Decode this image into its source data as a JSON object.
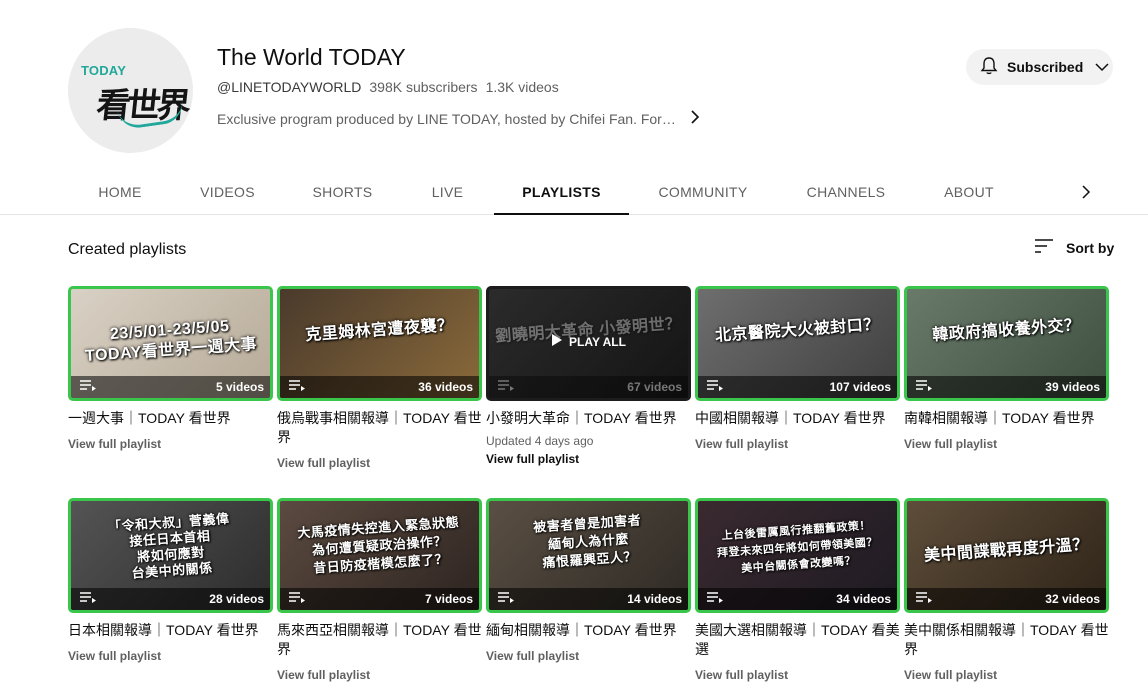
{
  "channel": {
    "avatar_text_en": "TODAY",
    "avatar_text_zh": "看世界",
    "name": "The World TODAY",
    "handle": "@LINETODAYWORLD",
    "subscribers": "398K subscribers",
    "video_count": "1.3K videos",
    "description": "Exclusive program produced by LINE TODAY, hosted by Chifei Fan. For Taiwan viewers",
    "subscribe_label": "Subscribed"
  },
  "tabs": [
    {
      "label": "HOME"
    },
    {
      "label": "VIDEOS"
    },
    {
      "label": "SHORTS"
    },
    {
      "label": "LIVE"
    },
    {
      "label": "PLAYLISTS",
      "active": true
    },
    {
      "label": "COMMUNITY"
    },
    {
      "label": "CHANNELS"
    },
    {
      "label": "ABOUT"
    }
  ],
  "section": {
    "title": "Created playlists",
    "sort_label": "Sort by"
  },
  "playlists": [
    {
      "thumb_text": "23/5/01-23/5/05\nTODAY看世界一週大事",
      "video_count": "5 videos",
      "title": "一週大事｜TODAY 看世界",
      "view_label": "View full playlist",
      "thumb_colors": [
        "#d9d1c5",
        "#b6aa97"
      ]
    },
    {
      "thumb_text": "克里姆林宮遭夜襲？",
      "video_count": "36 videos",
      "title": "俄烏戰事相關報導｜TODAY 看世界",
      "view_label": "View full playlist",
      "thumb_colors": [
        "#4a3a2c",
        "#8a6a3a"
      ]
    },
    {
      "thumb_text": "劉曉明大革命 小發明世？",
      "video_count": "67 videos",
      "title": "小發明大革命｜TODAY 看世界",
      "updated": "Updated 4 days ago",
      "view_label": "View full playlist",
      "play_all_label": "PLAY ALL",
      "thumb_colors": [
        "#2b2b2b",
        "#141414"
      ]
    },
    {
      "thumb_text": "北京醫院大火被封口？",
      "video_count": "107 videos",
      "title": "中國相關報導｜TODAY 看世界",
      "view_label": "View full playlist",
      "thumb_colors": [
        "#6e6e6e",
        "#3f3f3f"
      ]
    },
    {
      "thumb_text": "韓政府搞收養外交？",
      "video_count": "39 videos",
      "title": "南韓相關報導｜TODAY 看世界",
      "view_label": "View full playlist",
      "thumb_colors": [
        "#6a7a6a",
        "#3d4f3f"
      ]
    },
    {
      "thumb_text": "「令和大叔」菅義偉\n接任日本首相\n將如何應對\n台美中的關係",
      "video_count": "28 videos",
      "title": "日本相關報導｜TODAY 看世界",
      "view_label": "View full playlist",
      "thumb_colors": [
        "#545454",
        "#2c2c2c"
      ]
    },
    {
      "thumb_text": "大馬疫情失控進入緊急狀態\n為何遭質疑政治操作？\n昔日防疫楷模怎麼了？",
      "video_count": "7 videos",
      "title": "馬來西亞相關報導｜TODAY 看世界",
      "view_label": "View full playlist",
      "thumb_colors": [
        "#5b4a40",
        "#2d2420"
      ]
    },
    {
      "thumb_text": "被害者曾是加害者\n緬甸人為什麼\n痛恨羅興亞人？",
      "video_count": "14 videos",
      "title": "緬甸相關報導｜TODAY 看世界",
      "view_label": "View full playlist",
      "thumb_colors": [
        "#5a4f44",
        "#2e2a24"
      ]
    },
    {
      "thumb_text": "上台後雷厲風行推翻舊政策！\n拜登未來四年將如何帶領美國？\n美中台關係會改變嗎？",
      "video_count": "34 videos",
      "title": "美國大選相關報導｜TODAY 看美選",
      "view_label": "View full playlist",
      "thumb_colors": [
        "#3a2a30",
        "#1e1a22"
      ]
    },
    {
      "thumb_text": "美中間諜戰再度升溫？",
      "video_count": "32 videos",
      "title": "美中關係相關報導｜TODAY 看世界",
      "view_label": "View full playlist",
      "thumb_colors": [
        "#5e4d3a",
        "#2e2418"
      ]
    }
  ],
  "colors": {
    "accent_green": "#39c64a",
    "avatar_teal": "#21a89a",
    "text_primary": "#0f0f0f",
    "text_secondary": "#606060"
  }
}
